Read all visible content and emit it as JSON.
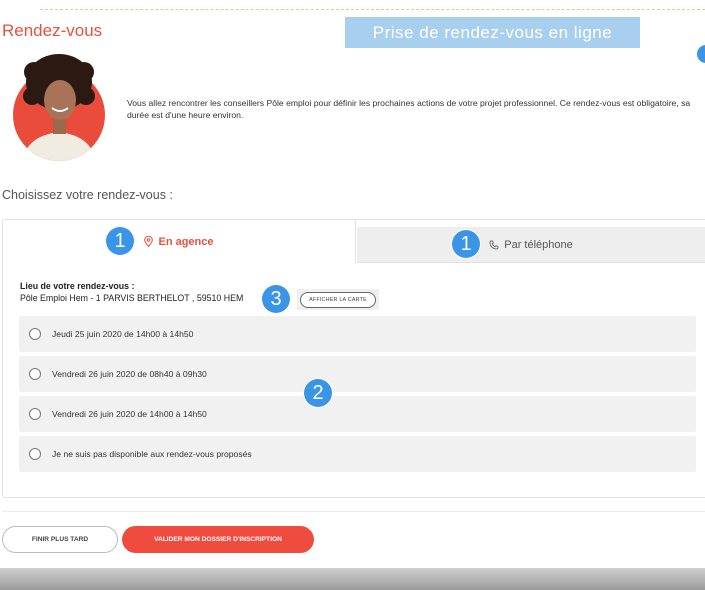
{
  "header": {
    "title": "Rendez-vous",
    "banner": "Prise de rendez-vous en ligne"
  },
  "intro": {
    "text": "Vous allez rencontrer les conseillers Pôle emploi pour définir les prochaines actions de votre projet professionnel. Ce rendez-vous est obligatoire, sa durée est d'une heure environ."
  },
  "choose_label": "Choisissez votre rendez-vous :",
  "tabs": [
    {
      "label": "En agence",
      "icon": "location-pin-icon",
      "active": true,
      "badge": "1"
    },
    {
      "label": "Par téléphone",
      "icon": "phone-icon",
      "active": false,
      "badge": "1"
    }
  ],
  "location": {
    "label": "Lieu de votre rendez-vous :",
    "value": "Pôle Emploi Hem - 1 PARVIS BERTHELOT , 59510 HEM",
    "map_button": "AFFICHER LA CARTE",
    "badge": "3"
  },
  "options": [
    {
      "label": "Jeudi 25 juin 2020 de 14h00 à 14h50"
    },
    {
      "label": "Vendredi 26 juin 2020 de 08h40 à 09h30"
    },
    {
      "label": "Vendredi 26 juin 2020 de 14h00 à 14h50"
    },
    {
      "label": "Je ne suis pas disponible aux rendez-vous proposés"
    }
  ],
  "options_badge": "2",
  "actions": {
    "later": "FINIR PLUS TARD",
    "validate": "VALIDER MON DOSSIER D'INSCRIPTION"
  },
  "colors": {
    "accent": "#e8503f",
    "badge": "#3b95e6",
    "banner": "#a9cfee"
  }
}
